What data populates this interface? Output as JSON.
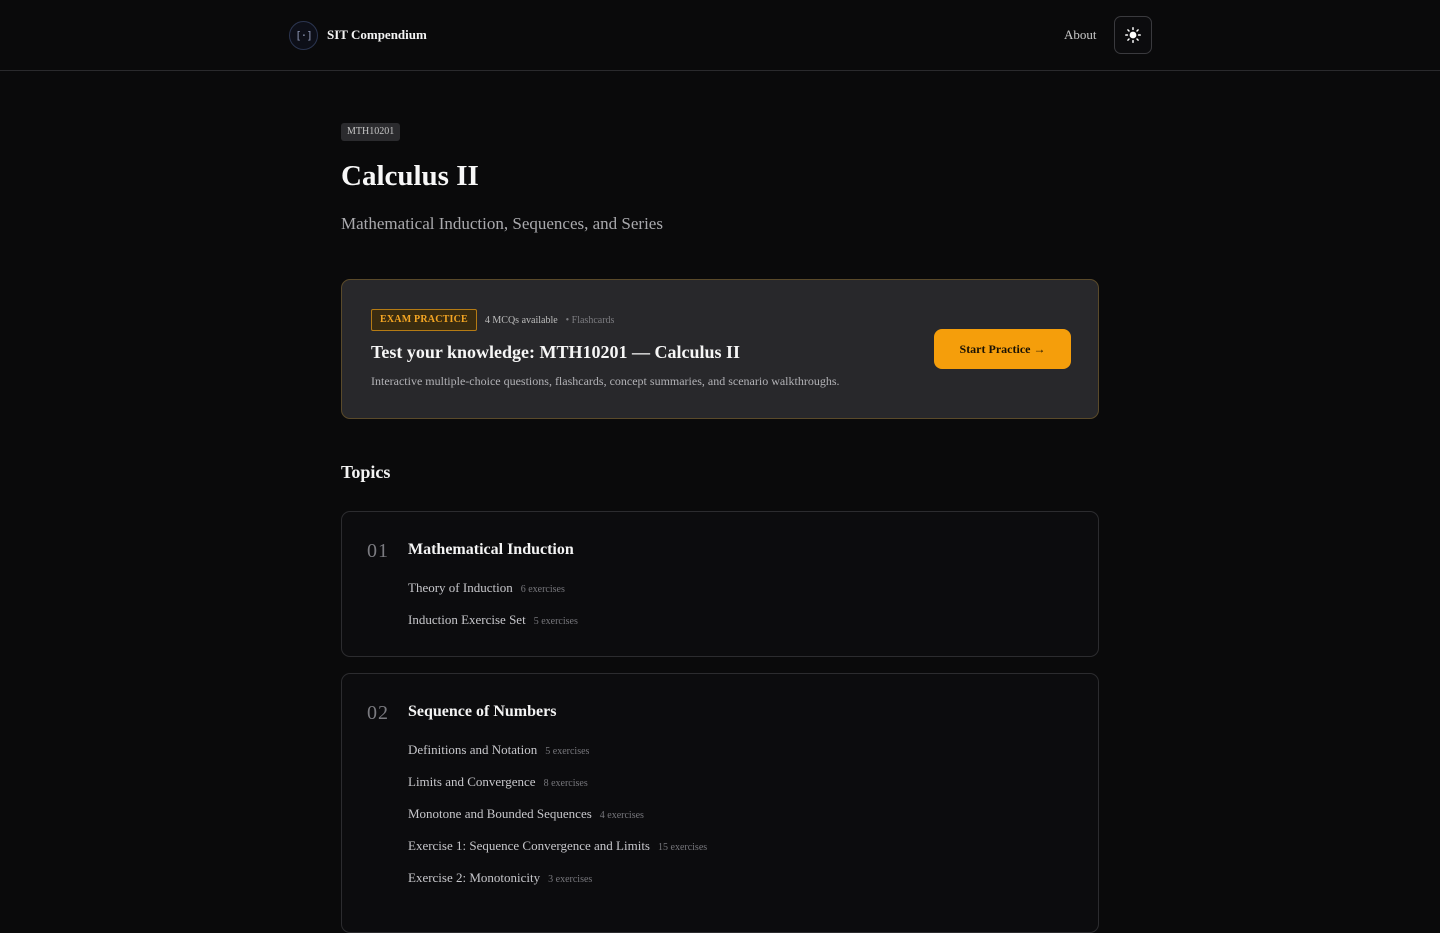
{
  "header": {
    "brand_logo_text": "[·]",
    "brand_name": "SIT Compendium",
    "about_label": "About",
    "theme_icon": "sun-icon"
  },
  "course": {
    "code": "MTH10201",
    "title": "Calculus II",
    "subtitle": "Mathematical Induction, Sequences, and Series"
  },
  "practice": {
    "tag": "EXAM PRACTICE",
    "mcq_count": "4 MCQs available",
    "flashcards": "• Flashcards",
    "title": "Test your knowledge: MTH10201 — Calculus II",
    "description": "Interactive multiple-choice questions, flashcards, concept summaries, and scenario walkthroughs.",
    "start_label": "Start Practice →"
  },
  "topics_heading": "Topics",
  "topics": [
    {
      "number": "01",
      "title": "Mathematical Induction",
      "items": [
        {
          "label": "Theory of Induction",
          "count": "6 exercises"
        },
        {
          "label": "Induction Exercise Set",
          "count": "5 exercises"
        }
      ]
    },
    {
      "number": "02",
      "title": "Sequence of Numbers",
      "items": [
        {
          "label": "Definitions and Notation",
          "count": "5 exercises"
        },
        {
          "label": "Limits and Convergence",
          "count": "8 exercises"
        },
        {
          "label": "Monotone and Bounded Sequences",
          "count": "4 exercises"
        },
        {
          "label": "Exercise 1: Sequence Convergence and Limits",
          "count": "15 exercises"
        },
        {
          "label": "Exercise 2: Monotonicity",
          "count": "3 exercises"
        }
      ]
    }
  ],
  "colors": {
    "accent": "#f59e0b",
    "background": "#0a0a0b",
    "card": "#28282b"
  }
}
